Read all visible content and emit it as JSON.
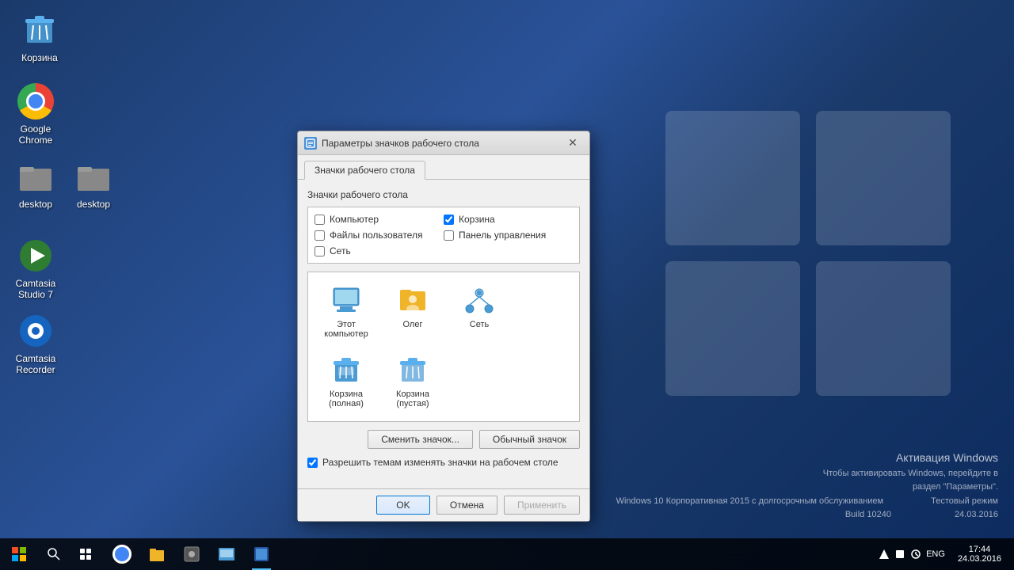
{
  "desktop": {
    "background_color": "#1a3a6b",
    "icons": [
      {
        "id": "recycle",
        "label": "Корзина",
        "type": "recycle"
      },
      {
        "id": "chrome",
        "label": "Google Chrome",
        "type": "chrome"
      },
      {
        "id": "desktop1",
        "label": "desktop",
        "type": "folder"
      },
      {
        "id": "desktop2",
        "label": "desktop",
        "type": "folder"
      },
      {
        "id": "camtasia1",
        "label": "Camtasia Studio 7",
        "type": "camtasia"
      },
      {
        "id": "camtasia2",
        "label": "Camtasia Recorder",
        "type": "camtasia2"
      }
    ]
  },
  "activation": {
    "title": "Активация Windows",
    "line1": "Чтобы активировать Windows, перейдите в",
    "line2": "раздел \"Параметры\".",
    "line3": "Тестовый режим",
    "line4": "Windows 10 Корпоративная 2015 с долгосрочным обслуживанием",
    "line5": "Build 10240",
    "line6": "24.03.2016"
  },
  "taskbar": {
    "clock": "17:44",
    "date": "24.03.2016",
    "lang": "ENG"
  },
  "dialog": {
    "title": "Параметры значков рабочего стола",
    "close_btn": "✕",
    "tabs": [
      {
        "id": "desktop-icons",
        "label": "Значки рабочего стола",
        "active": true
      }
    ],
    "section_label": "Значки рабочего стола",
    "checkboxes": [
      {
        "id": "computer",
        "label": "Компьютер",
        "checked": false
      },
      {
        "id": "recycle",
        "label": "Корзина",
        "checked": true
      },
      {
        "id": "user_files",
        "label": "Файлы пользователя",
        "checked": false
      },
      {
        "id": "control_panel",
        "label": "Панель управления",
        "checked": false
      },
      {
        "id": "network",
        "label": "Сеть",
        "checked": false
      }
    ],
    "icons": [
      {
        "id": "this_computer",
        "label": "Этот\nкомпьютер",
        "type": "computer",
        "selected": false
      },
      {
        "id": "user",
        "label": "Олег",
        "type": "user",
        "selected": false
      },
      {
        "id": "network",
        "label": "Сеть",
        "type": "network",
        "selected": false
      },
      {
        "id": "recycle_full",
        "label": "Корзина\n(полная)",
        "type": "recycle_full",
        "selected": false
      },
      {
        "id": "recycle_empty",
        "label": "Корзина\n(пустая)",
        "type": "recycle_empty",
        "selected": false
      }
    ],
    "btn_change": "Сменить значок...",
    "btn_default": "Обычный значок",
    "allow_themes_label": "Разрешить темам изменять значки на рабочем столе",
    "allow_themes_checked": true,
    "btn_ok": "OK",
    "btn_cancel": "Отмена",
    "btn_apply": "Применить"
  }
}
